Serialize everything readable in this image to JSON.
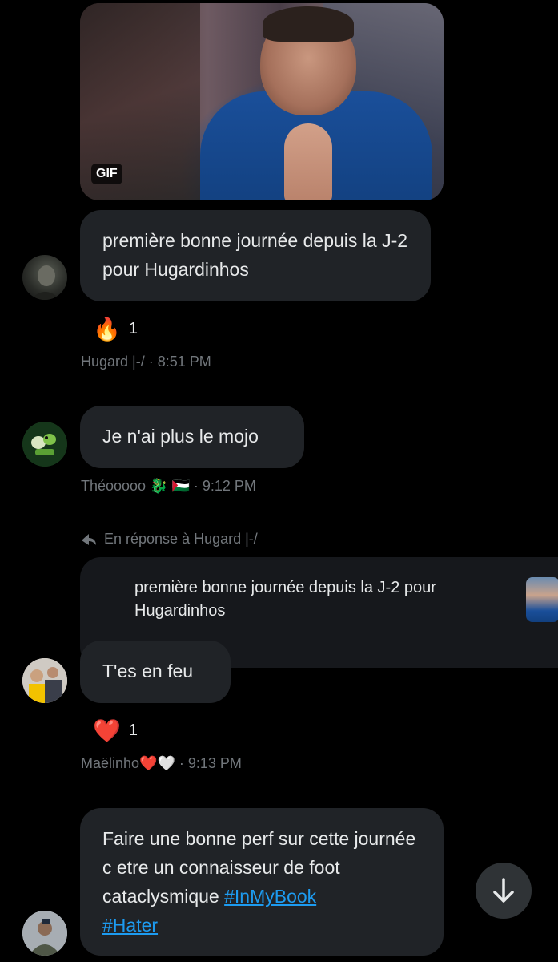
{
  "gif": {
    "badge": "GIF"
  },
  "messages": [
    {
      "text": "première bonne journée depuis la J-2 pour Hugardinhos",
      "reaction": {
        "emoji": "🔥",
        "count": "1"
      },
      "meta": "Hugard |-/ · 8:51 PM"
    },
    {
      "text": "Je n'ai plus le mojo",
      "meta": "Théooooo 🐉 🇵🇸 · 9:12 PM"
    },
    {
      "reply_label": "En réponse à Hugard |-/",
      "quoted_text": "première bonne journée depuis la J-2 pour Hugardinhos",
      "text": "T'es en feu",
      "reaction": {
        "emoji": "❤️",
        "count": "1"
      },
      "meta": "Maëlinho❤️🤍 · 9:13 PM"
    },
    {
      "text_plain": "Faire une bonne perf sur cette journée c etre un connaisseur de foot cataclysmique",
      "hashtags": [
        "#InMyBook",
        "#Hater"
      ]
    }
  ],
  "icons": {
    "reply": "reply-arrow-icon",
    "scroll": "arrow-down-icon"
  },
  "colors": {
    "background": "#000000",
    "bubble": "#202327",
    "meta_text": "#71767b",
    "link": "#1d9bf0"
  }
}
